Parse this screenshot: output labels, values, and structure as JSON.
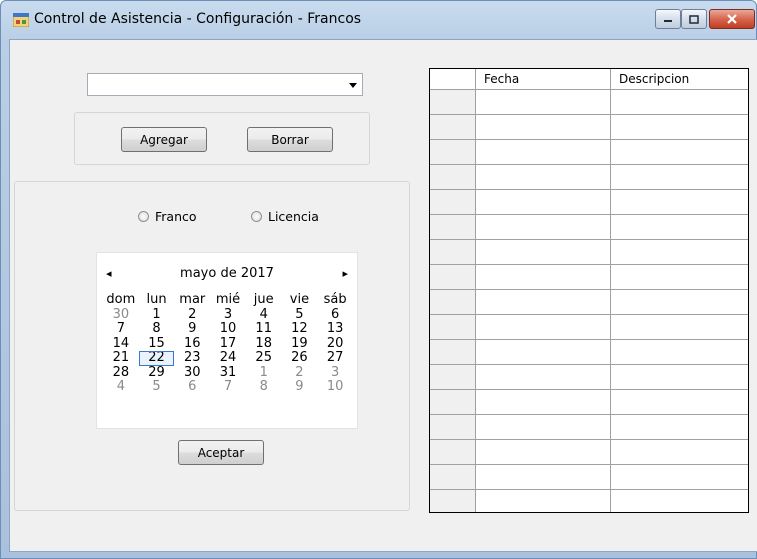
{
  "window": {
    "title": "Control de Asistencia - Configuración - Francos"
  },
  "combo": {
    "value": ""
  },
  "buttons": {
    "agregar": "Agregar",
    "borrar": "Borrar",
    "aceptar": "Aceptar"
  },
  "radios": {
    "franco": "Franco",
    "licencia": "Licencia"
  },
  "calendar": {
    "title": "mayo de 2017",
    "prev": "◂",
    "next": "▸",
    "dow": [
      "dom",
      "lun",
      "mar",
      "mié",
      "jue",
      "vie",
      "sáb"
    ],
    "weeks": [
      [
        "30",
        "1",
        "2",
        "3",
        "4",
        "5",
        "6"
      ],
      [
        "7",
        "8",
        "9",
        "10",
        "11",
        "12",
        "13"
      ],
      [
        "14",
        "15",
        "16",
        "17",
        "18",
        "19",
        "20"
      ],
      [
        "21",
        "22",
        "23",
        "24",
        "25",
        "26",
        "27"
      ],
      [
        "28",
        "29",
        "30",
        "31",
        "1",
        "2",
        "3"
      ],
      [
        "4",
        "5",
        "6",
        "7",
        "8",
        "9",
        "10"
      ]
    ],
    "other_month": [
      [
        0,
        0
      ],
      [
        4,
        4
      ],
      [
        4,
        5
      ],
      [
        4,
        6
      ],
      [
        5,
        0
      ],
      [
        5,
        1
      ],
      [
        5,
        2
      ],
      [
        5,
        3
      ],
      [
        5,
        4
      ],
      [
        5,
        5
      ],
      [
        5,
        6
      ]
    ],
    "selected": [
      3,
      1
    ]
  },
  "table": {
    "columns": [
      "Fecha",
      "Descripcion"
    ],
    "row_count": 17
  },
  "colors": {
    "window_bg": "#f0f0f0",
    "selection": "#3a78c9"
  }
}
